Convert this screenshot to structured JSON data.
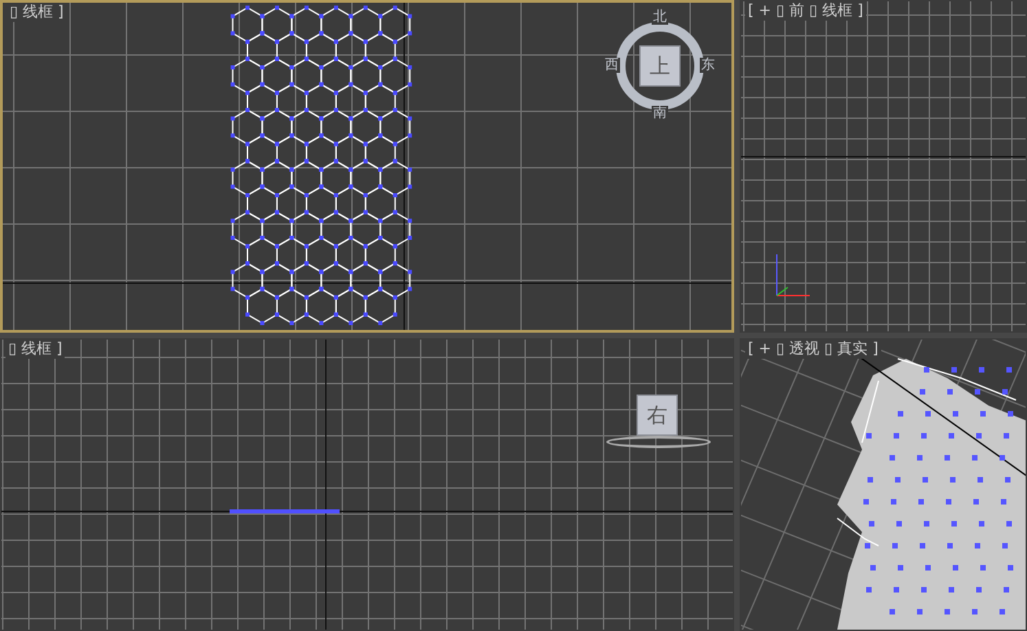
{
  "viewports": [
    {
      "kind": "top",
      "label": "▯ 线框 ]",
      "active": true,
      "viewcube": {
        "face": "上",
        "compass": [
          "北",
          "东",
          "南",
          "西"
        ]
      }
    },
    {
      "kind": "front",
      "label": "[ + ▯ 前 ▯ 线框 ]",
      "active": false
    },
    {
      "kind": "left",
      "label": "▯ 线框 ]",
      "active": false,
      "viewcube": {
        "face": "右"
      }
    },
    {
      "kind": "perspective",
      "label": "[ + ▯ 透视 ▯ 真实 ]",
      "active": false
    }
  ]
}
